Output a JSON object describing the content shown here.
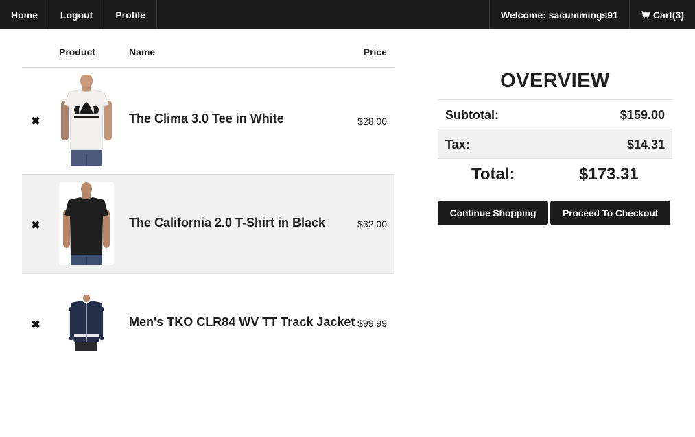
{
  "nav": {
    "home": "Home",
    "logout": "Logout",
    "profile": "Profile",
    "welcome": "Welcome: sacummings91",
    "cart": "Cart(3)",
    "cart_icon": "shopping-cart-icon"
  },
  "cart": {
    "headers": {
      "product": "Product",
      "name": "Name",
      "price": "Price"
    },
    "remove_symbol": "✖",
    "items": [
      {
        "name": "The Clima 3.0 Tee in White",
        "price": "$28.00",
        "image": "white-adidas-tee-photo"
      },
      {
        "name": "The California 2.0 T-Shirt in Black",
        "price": "$32.00",
        "image": "black-tshirt-photo"
      },
      {
        "name": "Men's TKO CLR84 WV TT Track Jacket",
        "price": "$99.99",
        "image": "navy-track-jacket-photo"
      }
    ]
  },
  "overview": {
    "title": "OVERVIEW",
    "subtotal_label": "Subtotal:",
    "subtotal": "$159.00",
    "tax_label": "Tax:",
    "tax": "$14.31",
    "total_label": "Total:",
    "total": "$173.31",
    "continue_label": "Continue Shopping",
    "checkout_label": "Proceed To Checkout"
  },
  "colors": {
    "navbar": "#1b1b1c",
    "button": "#1b1b1c",
    "row_alt": "#f1f1f1",
    "divider": "#dddddd"
  }
}
